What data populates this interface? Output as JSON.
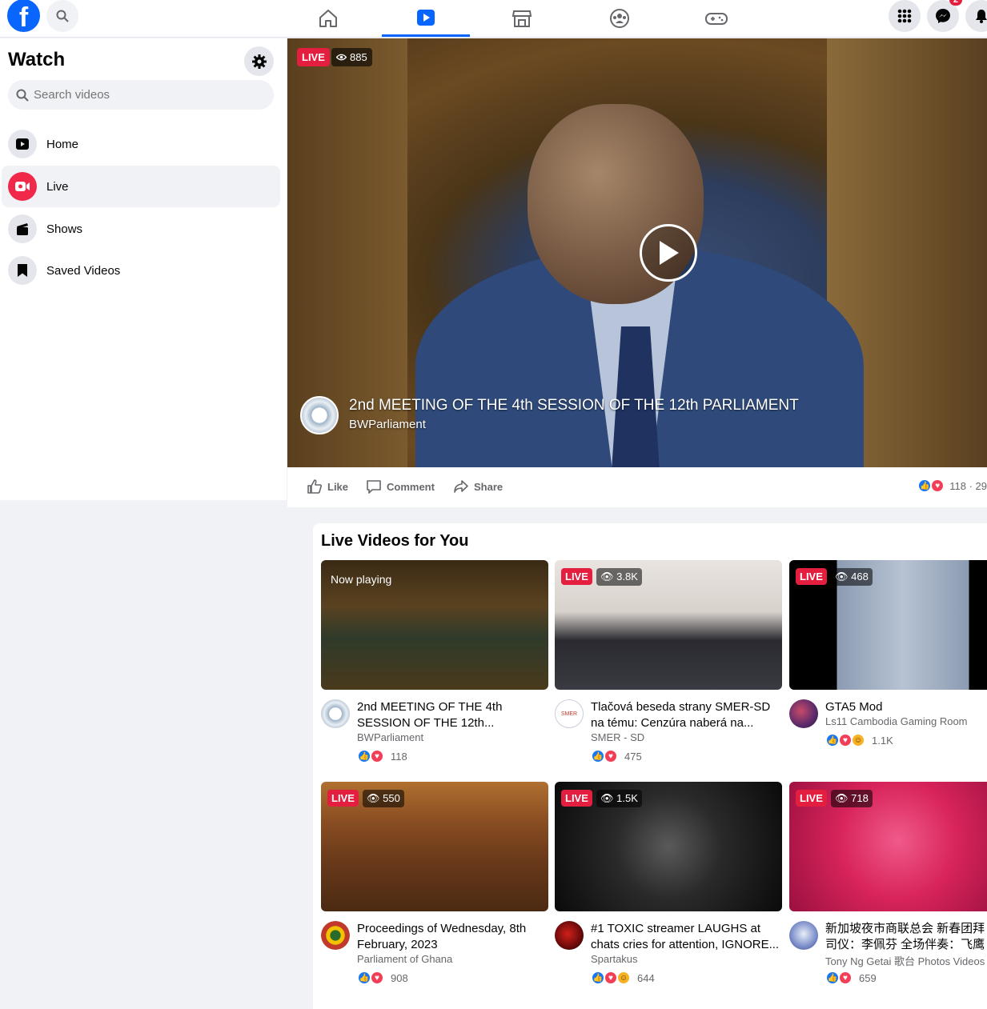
{
  "topbar": {
    "logo_letter": "f",
    "messenger_badge": "2"
  },
  "sidebar": {
    "title": "Watch",
    "search_placeholder": "Search videos",
    "items": [
      {
        "label": "Home"
      },
      {
        "label": "Live"
      },
      {
        "label": "Shows"
      },
      {
        "label": "Saved Videos"
      }
    ]
  },
  "player": {
    "live_label": "LIVE",
    "views": "885",
    "title": "2nd MEETING OF THE 4th SESSION OF THE 12th PARLIAMENT",
    "channel": "BWParliament",
    "actions": {
      "like": "Like",
      "comment": "Comment",
      "share": "Share"
    },
    "reaction_count": "118 · 29"
  },
  "live_section": {
    "title": "Live Videos for You",
    "now_playing": "Now playing",
    "live_label": "LIVE",
    "cards": [
      {
        "title": "2nd MEETING OF THE 4th SESSION OF THE 12th...",
        "channel": "BWParliament",
        "views": "",
        "reactions": "118"
      },
      {
        "title": "Tlačová beseda strany SMER-SD na tému: Cenzúra naberá na...",
        "channel": "SMER - SD",
        "views": "3.8K",
        "reactions": "475"
      },
      {
        "title": "GTA5 Mod",
        "channel": "Ls11 Cambodia Gaming Room",
        "views": "468",
        "reactions": "1.1K"
      },
      {
        "title": "Proceedings of Wednesday, 8th February, 2023",
        "channel": "Parliament of Ghana",
        "views": "550",
        "reactions": "908"
      },
      {
        "title": "#1 TOXIC streamer LAUGHS at chats cries for attention, IGNORE...",
        "channel": "Spartakus",
        "views": "1.5K",
        "reactions": "644"
      },
      {
        "title": "新加坡夜市商联总会 新春团拜 司仪：李佩芬 全场伴奏：飞鹰大",
        "channel": "Tony Ng Getai 歌台 Photos Videos",
        "views": "718",
        "reactions": "659"
      }
    ]
  },
  "colors": {
    "brand": "#0866ff",
    "live": "#e41e3f",
    "like": "#1877f2",
    "love": "#f33e58"
  }
}
